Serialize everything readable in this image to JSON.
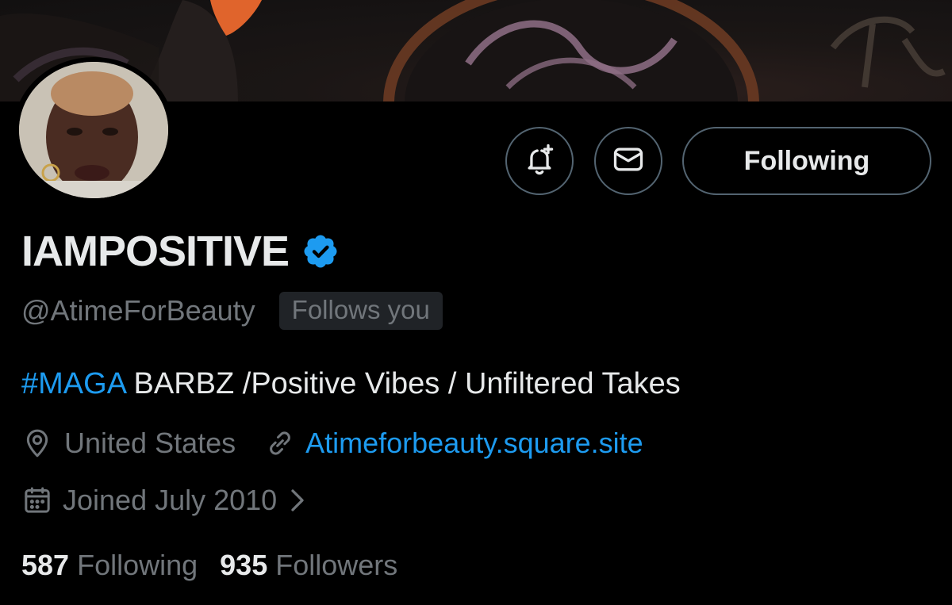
{
  "profile": {
    "display_name": "IAMPOSITIVE",
    "handle": "@AtimeForBeauty",
    "follows_you_badge": "Follows you",
    "bio_hashtag": "#MAGA",
    "bio_text": " BARBZ /Positive Vibes / Unfiltered Takes",
    "location": "United States",
    "website": "Atimeforbeauty.square.site",
    "joined": "Joined July 2010",
    "following_count": "587",
    "following_label": "Following",
    "followers_count": "935",
    "followers_label": "Followers"
  },
  "actions": {
    "follow_button_label": "Following",
    "notify_icon": "bell-plus-icon",
    "message_icon": "envelope-icon"
  },
  "colors": {
    "background": "#000000",
    "text_primary": "#e7e9ea",
    "text_secondary": "#71767b",
    "accent_link": "#1d9bf0",
    "verified_badge": "#1d9bf0",
    "button_border": "#536471",
    "badge_bg": "#202327"
  }
}
